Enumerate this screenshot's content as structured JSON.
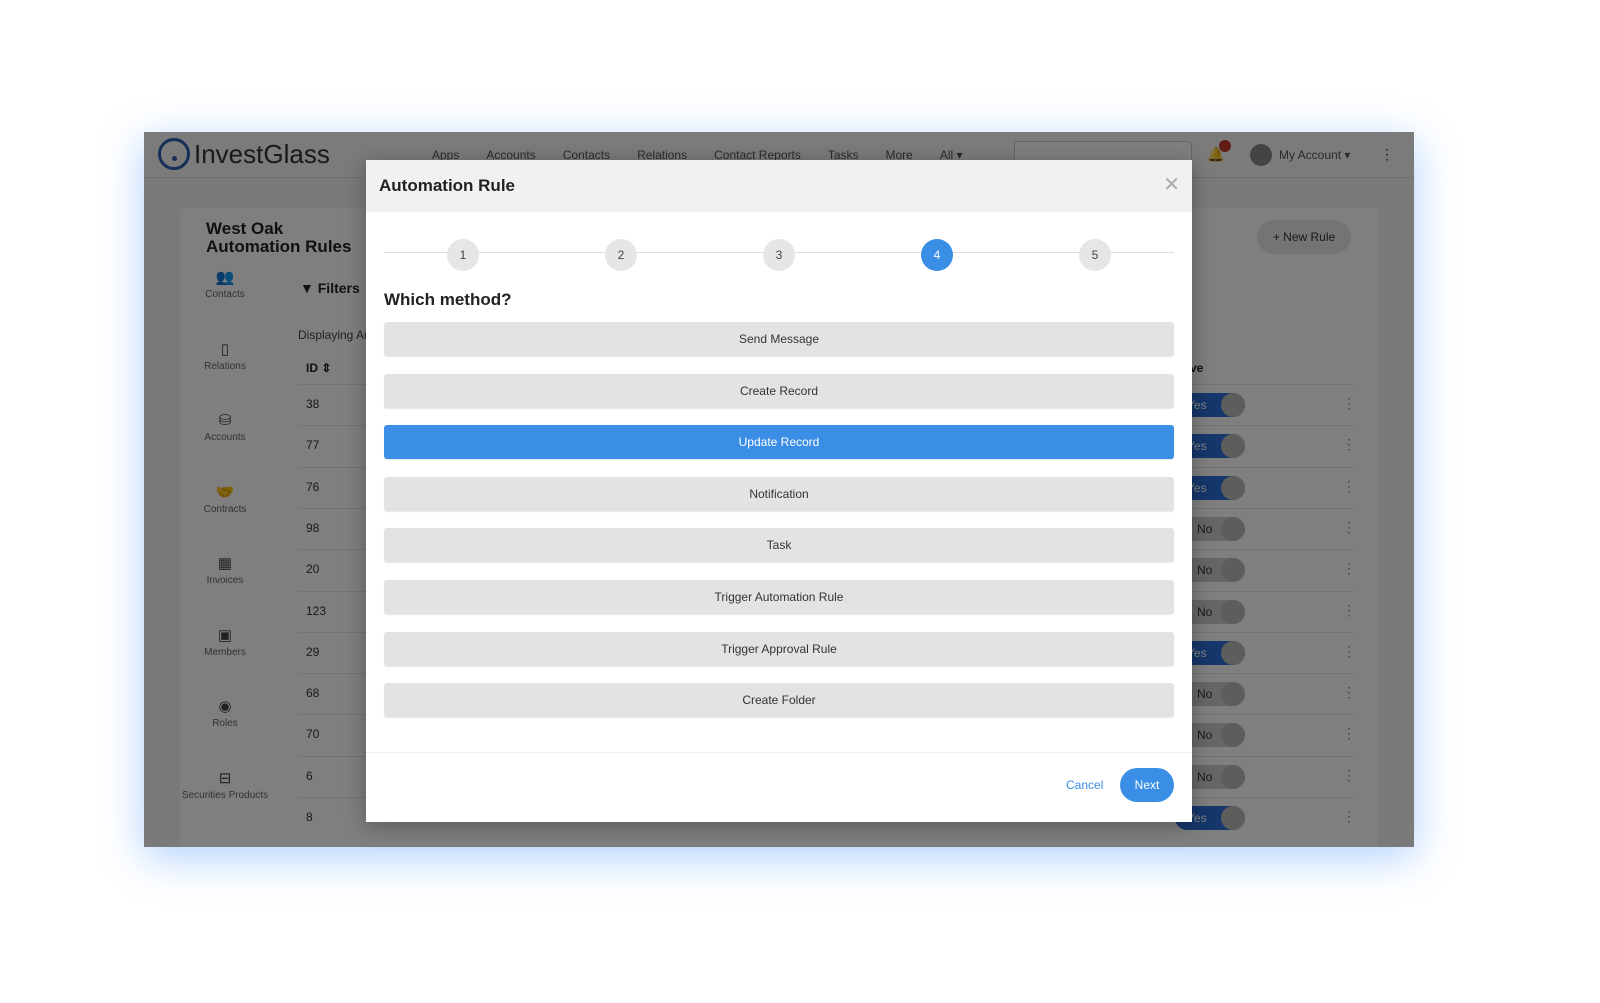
{
  "app": {
    "brand": "InvestGlass",
    "nav": [
      "Apps",
      "Accounts",
      "Contacts",
      "Relations",
      "Contact Reports",
      "Tasks",
      "More",
      "All ▾"
    ],
    "account": "My Account ▾",
    "notification_count": "1"
  },
  "page": {
    "title_line1": "West Oak",
    "title_line2": "Automation Rules",
    "new_rule": "+ New Rule",
    "filters": "Filters",
    "displaying": "Displaying Au",
    "id_header": "ID ⇕",
    "active_header": "ve"
  },
  "sidebar": [
    {
      "label": "Contacts",
      "icon": "users-icon"
    },
    {
      "label": "Relations",
      "icon": "building-icon"
    },
    {
      "label": "Accounts",
      "icon": "coins-icon"
    },
    {
      "label": "Contracts",
      "icon": "handshake-icon"
    },
    {
      "label": "Invoices",
      "icon": "calculator-icon"
    },
    {
      "label": "Members",
      "icon": "id-badge-icon"
    },
    {
      "label": "Roles",
      "icon": "user-circle-icon"
    },
    {
      "label": "Securities Products",
      "icon": "basket-icon"
    }
  ],
  "rows": [
    {
      "id": "38",
      "active": "Yes"
    },
    {
      "id": "77",
      "active": "Yes"
    },
    {
      "id": "76",
      "active": "Yes"
    },
    {
      "id": "98",
      "active": "No"
    },
    {
      "id": "20",
      "active": "No"
    },
    {
      "id": "123",
      "active": "No"
    },
    {
      "id": "29",
      "active": "Yes"
    },
    {
      "id": "68",
      "active": "No"
    },
    {
      "id": "70",
      "active": "No"
    },
    {
      "id": "6",
      "active": "No"
    },
    {
      "id": "8",
      "active": "Yes"
    }
  ],
  "modal": {
    "title": "Automation Rule",
    "steps": [
      "1",
      "2",
      "3",
      "4",
      "5"
    ],
    "current_step": 4,
    "question": "Which method?",
    "options": [
      "Send Message",
      "Create Record",
      "Update Record",
      "Notification",
      "Task",
      "Trigger Automation Rule",
      "Trigger Approval Rule",
      "Create Folder"
    ],
    "selected": "Update Record",
    "cancel": "Cancel",
    "next": "Next"
  },
  "colors": {
    "accent": "#3a8ee6",
    "toggle_on": "#2d6fd6"
  }
}
